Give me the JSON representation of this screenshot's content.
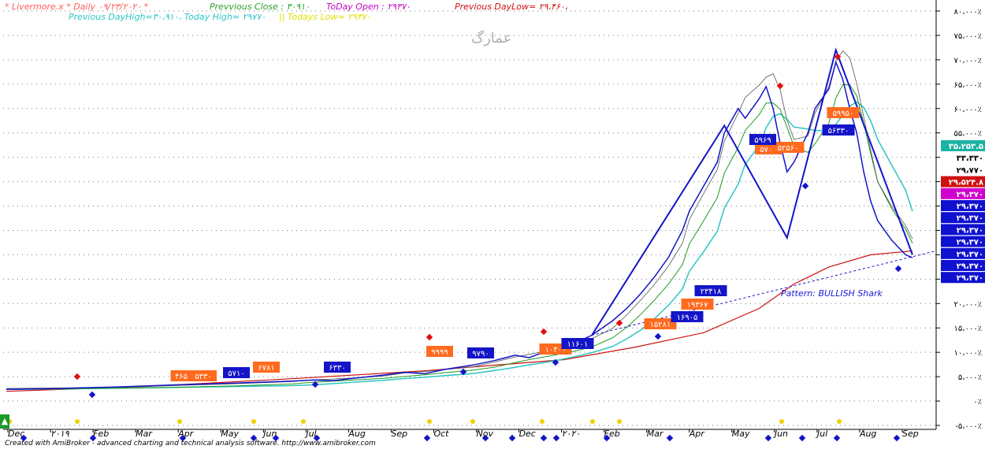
{
  "header": {
    "line1": [
      {
        "text": "* Livermore.x * Daily ۰۹/۲۳/۲۰۲۰ *",
        "color": "#ff5a5a"
      },
      {
        "text": "Prevvious Close : ۳۰۹۱۰",
        "color": "#2aa12a"
      },
      {
        "text": "ToDay Open : ۲۹۳۷۰",
        "color": "#c400c4"
      },
      {
        "text": "Previous DayLow= ۲۹،۴۶۰،",
        "color": "#d01010"
      }
    ],
    "line2": [
      {
        "text": "Previous DayHigh=۳۰،۹۱۰، Today High= ۲۹۷۷۰",
        "color": "#2cc4c4"
      },
      {
        "text": "||  Todays Low= ۲۹۳۷۰",
        "color": "#e0e000"
      }
    ]
  },
  "watermark": "عمارگ",
  "footer": "Created with AmiBroker - advanced charting and technical analysis software. http://www.amibroker.com",
  "pattern_label": "Pattern: BULLISH Shark",
  "up_arrow_icon": "up-arrow-icon",
  "chart_data": {
    "type": "line",
    "x": [
      "Dec",
      "۲۰۱۹",
      "Feb",
      "Mar",
      "Apr",
      "May",
      "Jun",
      "Jul",
      "Aug",
      "Sep",
      "Oct",
      "Nov",
      "Dec",
      "۲۰۲۰",
      "Feb",
      "Mar",
      "Apr",
      "May",
      "Jun",
      "Jul",
      "Aug",
      "Sep"
    ],
    "y_ticks": [
      "۸۰،۰۰۰٪",
      "۷۵،۰۰۰٪",
      "۷۰،۰۰۰٪",
      "۶۵،۰۰۰٪",
      "۶۰،۰۰۰٪",
      "۵۵،۰۰۰٪",
      "۵۰،۰۰۰٪",
      "۴۵،۰۰۰٪",
      "۴۰،۰۰۰٪",
      "۳۵،۰۰۰٪",
      "۳۰،۰۰۰٪",
      "۲۵،۰۰۰٪",
      "۲۰،۰۰۰٪",
      "۱۵،۰۰۰٪",
      "۱۰،۰۰۰٪",
      "۵،۰۰۰٪",
      "۰٪",
      "-۵،۰۰۰٪"
    ],
    "ylim": [
      -5000,
      80000
    ],
    "price": [
      [
        0,
        2400
      ],
      [
        8,
        2600
      ],
      [
        16,
        2900
      ],
      [
        24,
        3300
      ],
      [
        33,
        3700
      ],
      [
        41,
        4100
      ],
      [
        44,
        4300
      ],
      [
        47,
        4200
      ],
      [
        50,
        4700
      ],
      [
        54,
        5300
      ],
      [
        57,
        5900
      ],
      [
        60,
        5600
      ],
      [
        63,
        6500
      ],
      [
        67,
        7400
      ],
      [
        70,
        8300
      ],
      [
        73,
        9400
      ],
      [
        75,
        8900
      ],
      [
        78,
        10500
      ],
      [
        81,
        11500
      ],
      [
        84,
        13500
      ],
      [
        87,
        16500
      ],
      [
        89,
        19000
      ],
      [
        91,
        22000
      ],
      [
        93,
        25500
      ],
      [
        95,
        29500
      ],
      [
        97,
        35000
      ],
      [
        98,
        39000
      ],
      [
        100,
        44000
      ],
      [
        102,
        49000
      ],
      [
        103,
        55000
      ],
      [
        105,
        60000
      ],
      [
        106,
        58000
      ],
      [
        108,
        62000
      ],
      [
        109,
        64500
      ],
      [
        110,
        60000
      ],
      [
        111,
        53000
      ],
      [
        112,
        47000
      ],
      [
        113,
        49000
      ],
      [
        115,
        55000
      ],
      [
        116,
        60000
      ],
      [
        118,
        64000
      ],
      [
        119,
        69500
      ],
      [
        120,
        66000
      ],
      [
        121,
        60000
      ],
      [
        122,
        55000
      ],
      [
        123,
        47000
      ],
      [
        124,
        41000
      ],
      [
        125,
        37000
      ],
      [
        127,
        33000
      ],
      [
        129,
        30000
      ],
      [
        130,
        29400
      ]
    ],
    "ma_long": [
      [
        0,
        2000
      ],
      [
        20,
        3000
      ],
      [
        40,
        4500
      ],
      [
        60,
        6200
      ],
      [
        80,
        8500
      ],
      [
        90,
        11000
      ],
      [
        100,
        14000
      ],
      [
        108,
        19000
      ],
      [
        113,
        24000
      ],
      [
        118,
        27500
      ],
      [
        124,
        30000
      ],
      [
        130,
        30800
      ]
    ],
    "orange_labels": [
      "۴۶۵",
      "۵۳۳۰",
      "۶۷۸۱",
      "۹۹۹۹",
      "۱۰۴۰۰",
      "۱۵۲۸۱",
      "۱۹۳۶۷",
      "۵۷۰۰",
      "۵۲۵۶۰",
      "۵۹۹۵۰"
    ],
    "blue_labels": [
      "۵۷۱۰",
      "۶۳۳۰",
      "۹۷۹۰",
      "۱۱۶۰۱",
      "۱۶۹۰۵",
      "۲۳۴۱۸",
      "۵۹۶۹",
      "۵۶۳۳۰"
    ],
    "right_tags": [
      {
        "text": "۳۵،۲۵۳.۵",
        "bg": "#1bb3a4",
        "fg": "#ffffff"
      },
      {
        "text": "۳۳،۳۳۰",
        "bg": "#ffffff",
        "fg": "#000000"
      },
      {
        "text": "۲۹،۷۷۰",
        "bg": "#ffffff",
        "fg": "#000000"
      },
      {
        "text": "۲۹،۵۲۴.۸",
        "bg": "#d01010",
        "fg": "#ffffff"
      },
      {
        "text": "۲۹،۳۷۰",
        "bg": "#d000d0",
        "fg": "#ffffff"
      },
      {
        "text": "۲۹،۳۷۰",
        "bg": "#1010d0",
        "fg": "#ffffff"
      },
      {
        "text": "۲۹،۳۷۰",
        "bg": "#1010d0",
        "fg": "#ffffff"
      },
      {
        "text": "۲۹،۳۷۰",
        "bg": "#1010d0",
        "fg": "#ffffff"
      },
      {
        "text": "۲۹،۳۷۰",
        "bg": "#1010d0",
        "fg": "#ffffff"
      },
      {
        "text": "۲۹،۳۷۰",
        "bg": "#1010d0",
        "fg": "#ffffff"
      },
      {
        "text": "۲۹،۳۷۰",
        "bg": "#1010d0",
        "fg": "#ffffff"
      },
      {
        "text": "۲۹،۳۷۰",
        "bg": "#1010d0",
        "fg": "#ffffff"
      }
    ]
  }
}
